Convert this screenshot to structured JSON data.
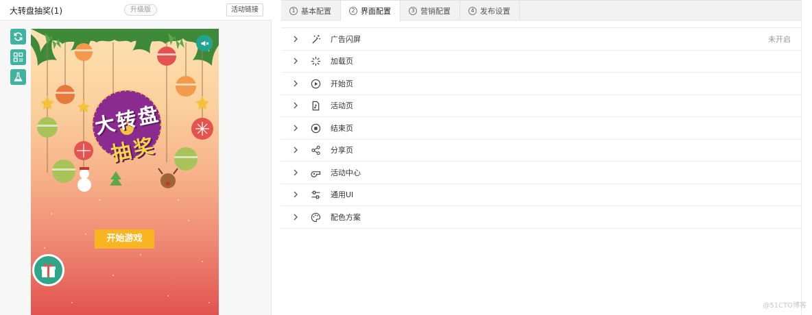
{
  "left": {
    "title": "大转盘抽奖(1)",
    "version_badge": "升级版",
    "link_button": "活动链接",
    "tools": [
      "refresh-icon",
      "qrcode-icon",
      "flask-icon"
    ]
  },
  "preview": {
    "logo_line1": "大转盘",
    "logo_line2": "抽奖",
    "start_button": "开始游戏",
    "sound_icon": "sound-off-icon",
    "gift_icon": "gift-icon"
  },
  "tabs": [
    {
      "num": "1",
      "label": "基本配置",
      "active": false
    },
    {
      "num": "2",
      "label": "界面配置",
      "active": true
    },
    {
      "num": "3",
      "label": "营销配置",
      "active": false
    },
    {
      "num": "4",
      "label": "发布设置",
      "active": false
    }
  ],
  "sections": [
    {
      "icon": "magic-wand-icon",
      "label": "广告闪屏",
      "status": "未开启"
    },
    {
      "icon": "loading-spinner-icon",
      "label": "加载页",
      "status": ""
    },
    {
      "icon": "play-circle-icon",
      "label": "开始页",
      "status": ""
    },
    {
      "icon": "music-file-icon",
      "label": "活动页",
      "status": ""
    },
    {
      "icon": "stop-circle-icon",
      "label": "结束页",
      "status": ""
    },
    {
      "icon": "share-icon",
      "label": "分享页",
      "status": ""
    },
    {
      "icon": "whistle-icon",
      "label": "活动中心",
      "status": ""
    },
    {
      "icon": "sliders-icon",
      "label": "通用UI",
      "status": ""
    },
    {
      "icon": "palette-icon",
      "label": "配色方案",
      "status": ""
    }
  ],
  "watermark": "@51CTO博客",
  "colors": {
    "accent": "#3fb3a0",
    "start_button": "#f9b521",
    "gift": "#2fa68a"
  }
}
